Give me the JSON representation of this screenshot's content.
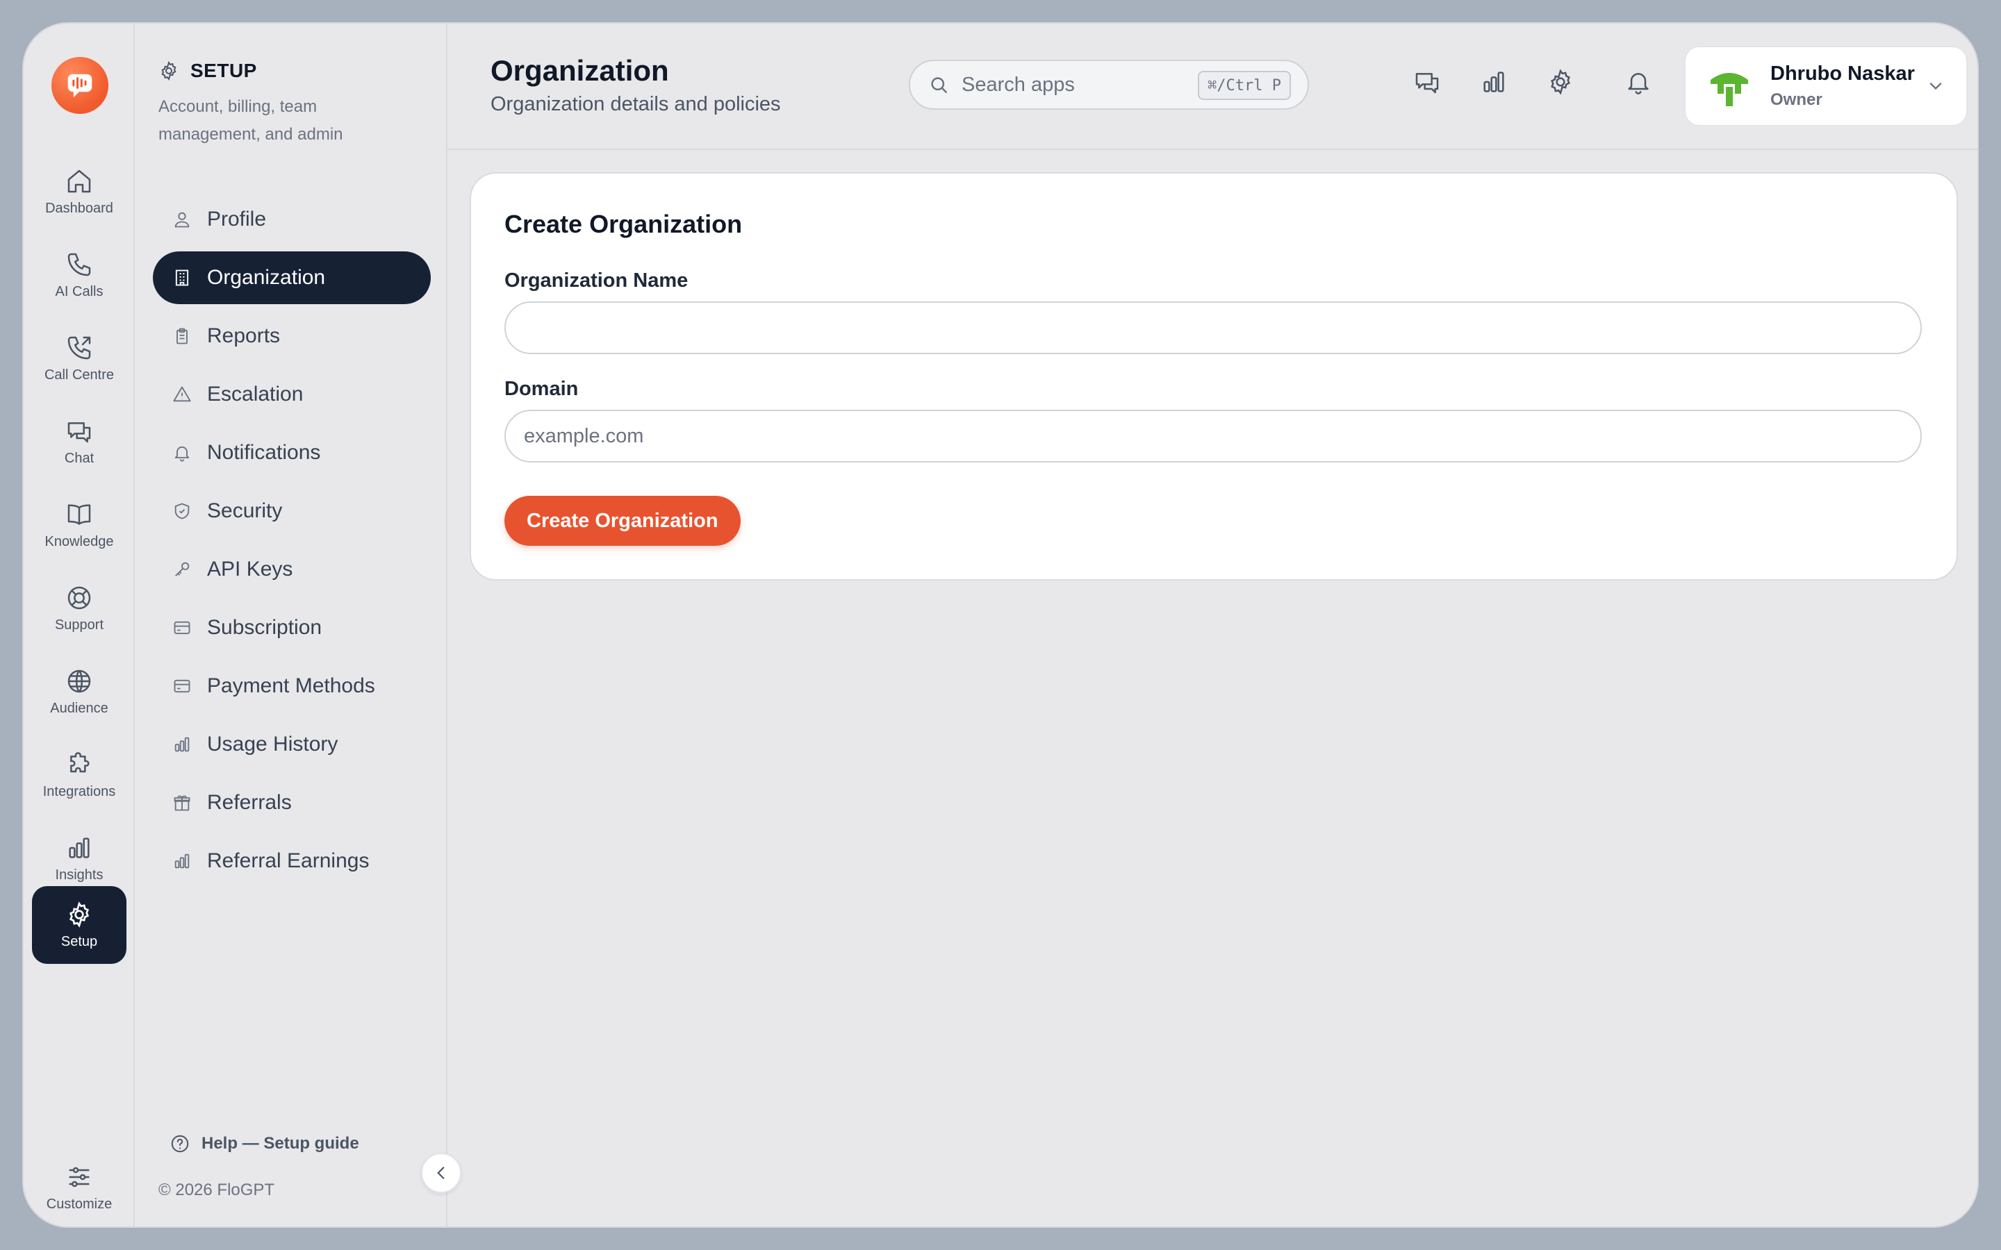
{
  "rail": {
    "items": [
      {
        "label": "Dashboard",
        "icon": "home-icon"
      },
      {
        "label": "AI Calls",
        "icon": "phone-icon"
      },
      {
        "label": "Call Centre",
        "icon": "phone-outgoing-icon"
      },
      {
        "label": "Chat",
        "icon": "chat-icon"
      },
      {
        "label": "Knowledge",
        "icon": "book-icon"
      },
      {
        "label": "Support",
        "icon": "lifebuoy-icon"
      },
      {
        "label": "Audience",
        "icon": "globe-icon"
      },
      {
        "label": "Integrations",
        "icon": "puzzle-icon"
      },
      {
        "label": "Insights",
        "icon": "bar-chart-icon"
      },
      {
        "label": "Setup",
        "icon": "gear-icon"
      }
    ],
    "active": "Setup",
    "customize_label": "Customize"
  },
  "sidebar": {
    "title": "SETUP",
    "description": "Account, billing, team management, and admin",
    "items": [
      {
        "label": "Profile",
        "icon": "user-icon"
      },
      {
        "label": "Organization",
        "icon": "building-icon"
      },
      {
        "label": "Reports",
        "icon": "clipboard-icon"
      },
      {
        "label": "Escalation",
        "icon": "alert-triangle-icon"
      },
      {
        "label": "Notifications",
        "icon": "bell-icon"
      },
      {
        "label": "Security",
        "icon": "shield-icon"
      },
      {
        "label": "API Keys",
        "icon": "key-icon"
      },
      {
        "label": "Subscription",
        "icon": "credit-card-icon"
      },
      {
        "label": "Payment Methods",
        "icon": "credit-card-icon"
      },
      {
        "label": "Usage History",
        "icon": "bar-chart-icon"
      },
      {
        "label": "Referrals",
        "icon": "gift-icon"
      },
      {
        "label": "Referral Earnings",
        "icon": "bar-chart-icon"
      }
    ],
    "active": "Organization",
    "help_label": "Help — Setup guide",
    "copyright": "© 2026 FloGPT"
  },
  "header": {
    "title": "Organization",
    "subtitle": "Organization details and policies",
    "search": {
      "placeholder": "Search apps",
      "shortcut": "⌘/Ctrl P"
    },
    "icons": [
      "chat-icon",
      "bar-chart-icon",
      "gear-icon",
      "bell-icon"
    ],
    "user": {
      "name": "Dhrubo Naskar",
      "role": "Owner"
    }
  },
  "form": {
    "title": "Create Organization",
    "name_label": "Organization Name",
    "name_value": "",
    "name_placeholder": "",
    "domain_label": "Domain",
    "domain_value": "",
    "domain_placeholder": "example.com",
    "submit_label": "Create Organization"
  },
  "colors": {
    "accent": "#e8532f",
    "active_nav": "#162234",
    "background": "#e8e8eb"
  }
}
